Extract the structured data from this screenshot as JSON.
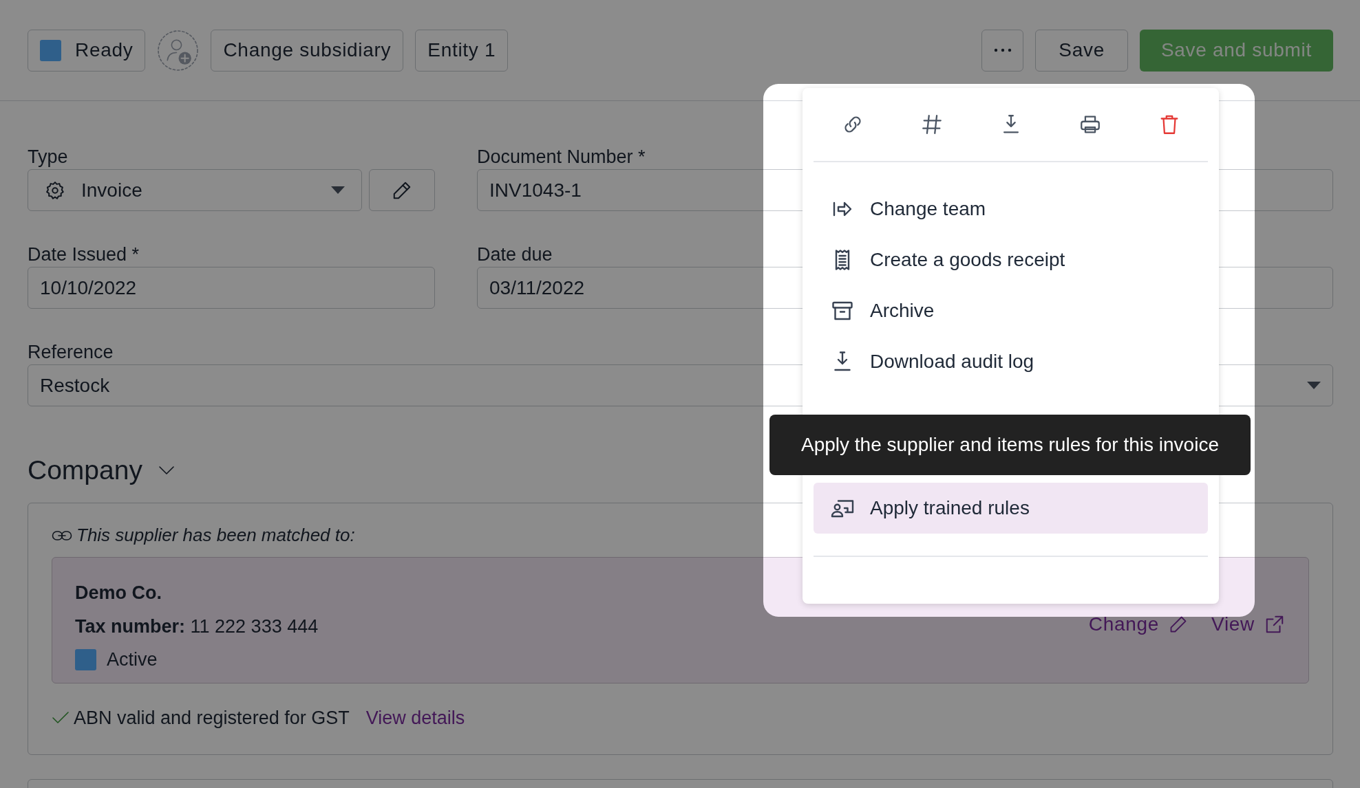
{
  "toolbar": {
    "status": {
      "label": "Ready",
      "color": "#2f5f8a"
    },
    "buttons": [
      "Change subsidiary",
      "Entity 1"
    ],
    "save": "Save",
    "submit": "Save and submit"
  },
  "form": {
    "type": {
      "label": "Type",
      "value": "Invoice"
    },
    "document_number": {
      "label": "Document Number *",
      "value": "INV1043-1"
    },
    "date_issued": {
      "label": "Date Issued *",
      "value": "10/10/2022"
    },
    "date_due": {
      "label": "Date due",
      "value": "03/11/2022"
    },
    "reference": {
      "label": "Reference",
      "value": "Restock"
    }
  },
  "company": {
    "title": "Company",
    "matched_text": "This supplier has been matched to:",
    "supplier": {
      "name": "Demo Co.",
      "tax": "**Tax number:** 11 222 333 444",
      "status": {
        "label": "Active",
        "color": "#2f5f8a"
      }
    },
    "links": [
      "Change",
      "View"
    ],
    "abn": "ABN valid and registered for GST",
    "abn_link": "View details"
  },
  "menu": {
    "actions": [
      {
        "kind": "link"
      },
      {
        "kind": "hash"
      },
      {
        "kind": "download"
      },
      {
        "kind": "print"
      },
      {
        "kind": "delete"
      }
    ],
    "items": [
      {
        "label": "Change team",
        "kind": "team",
        "selected": false
      },
      {
        "label": "Create a goods receipt",
        "kind": "receipt",
        "selected": false
      },
      {
        "label": "Archive",
        "kind": "archive",
        "selected": false
      },
      {
        "label": "Download audit log",
        "kind": "download",
        "selected": false
      },
      {
        "label": "Apply trained rules",
        "kind": "rules",
        "selected": true
      }
    ]
  },
  "tooltip": "Apply the supplier and items rules for this invoice"
}
